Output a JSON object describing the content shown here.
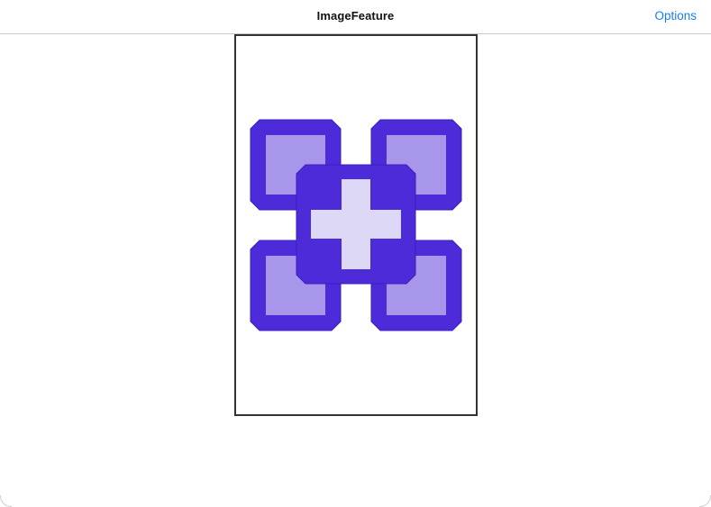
{
  "navbar": {
    "title": "ImageFeature",
    "options_label": "Options"
  },
  "image_view": {
    "icon": "four-squares-plus-icon",
    "colors": {
      "dark": "#4d2bd8",
      "medium": "#a796ea",
      "light": "#ddd8f6",
      "frame_border": "#333333",
      "accent": "#1a7cf2"
    }
  }
}
